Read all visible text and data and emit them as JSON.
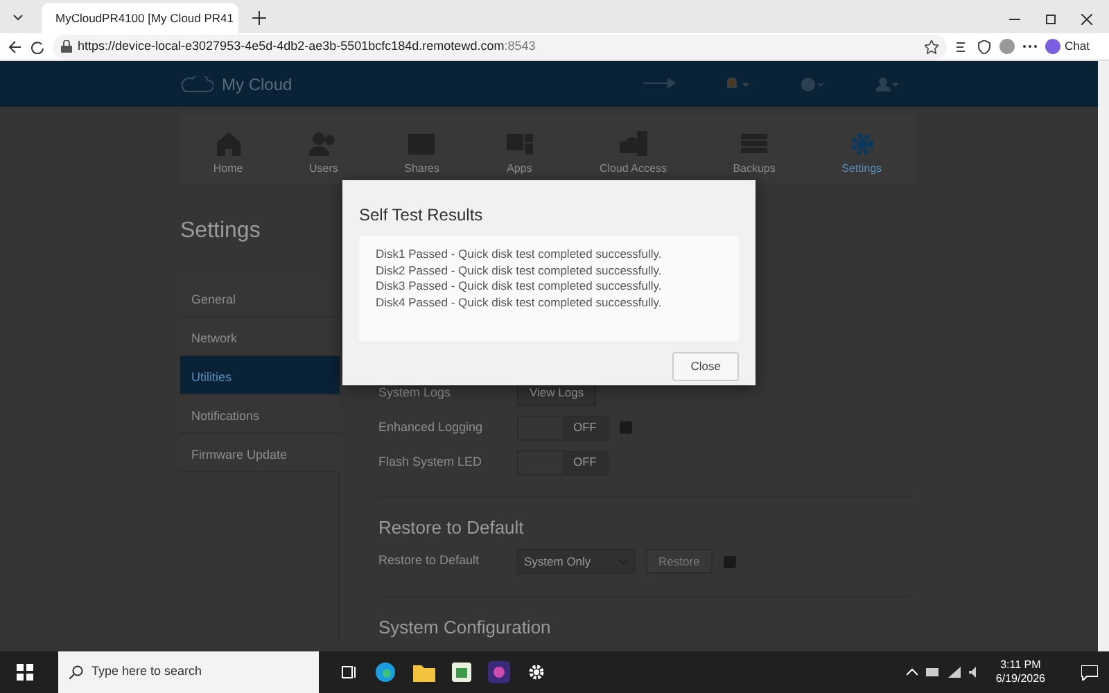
{
  "browser": {
    "tab_title": "MyCloudPR4100 [My Cloud PR41",
    "url_main": "https://device-local-e3027953-4e5d-4db2-ae3b-5501bcfc184d.remotewd.com",
    "url_port": ":8543",
    "chat_label": "Chat"
  },
  "app": {
    "brand": "My Cloud",
    "nav": [
      {
        "label": "Home",
        "kind": "home",
        "selected": false
      },
      {
        "label": "Users",
        "kind": "users",
        "selected": false
      },
      {
        "label": "Shares",
        "kind": "shares",
        "selected": false
      },
      {
        "label": "Apps",
        "kind": "apps",
        "selected": false
      },
      {
        "label": "Cloud Access",
        "kind": "cloud",
        "selected": false
      },
      {
        "label": "Backups",
        "kind": "backups",
        "selected": false
      },
      {
        "label": "Settings",
        "kind": "settings",
        "selected": true
      }
    ],
    "page_title": "Settings",
    "sidebar": [
      {
        "label": "General",
        "selected": false
      },
      {
        "label": "Network",
        "selected": false
      },
      {
        "label": "Utilities",
        "selected": true
      },
      {
        "label": "Notifications",
        "selected": false
      },
      {
        "label": "Firmware Update",
        "selected": false
      }
    ],
    "system_logs": {
      "label": "System Logs",
      "button": "View Logs"
    },
    "toggles": [
      {
        "label": "Enhanced Logging",
        "state_text": "OFF",
        "on": false,
        "has_info": true
      },
      {
        "label": "Flash System LED",
        "state_text": "OFF",
        "on": false,
        "has_info": false
      }
    ],
    "restore": {
      "heading": "Restore to Default",
      "label": "Restore to Default",
      "select_value": "System Only",
      "button": "Restore",
      "button_disabled": true
    },
    "config_heading": "System Configuration"
  },
  "dialog": {
    "title": "Self Test Results",
    "lines": [
      "Disk1 Passed - Quick disk test completed successfully.",
      "Disk2 Passed - Quick disk test completed successfully.",
      "Disk3 Passed - Quick disk test completed successfully.",
      "Disk4 Passed - Quick disk test completed successfully."
    ],
    "close": "Close"
  },
  "taskbar": {
    "search_placeholder": "Type here to search",
    "time": "3:11 PM",
    "date": "6/19/2026"
  }
}
